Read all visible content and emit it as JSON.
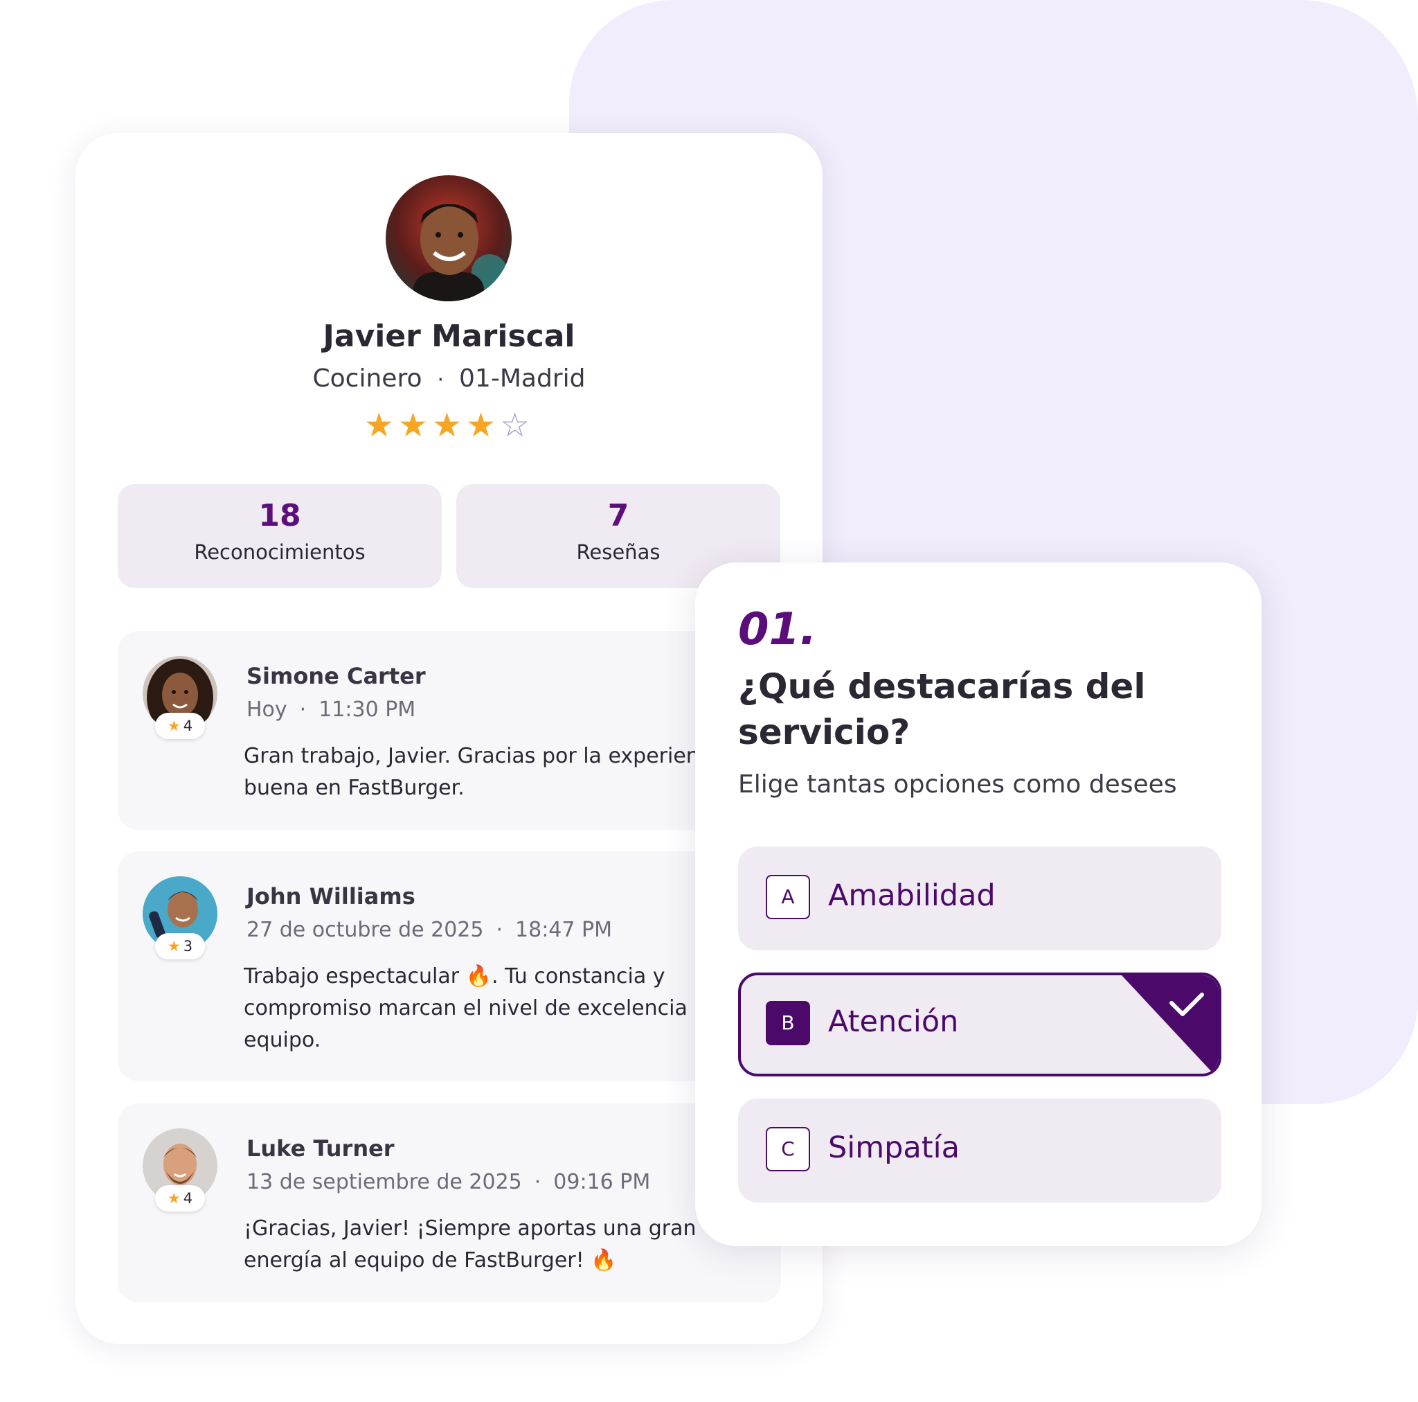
{
  "profile": {
    "name": "Javier Mariscal",
    "role": "Cocinero",
    "location": "01-Madrid",
    "separator": "·",
    "rating": 4,
    "rating_max": 5,
    "stats": [
      {
        "value": "18",
        "label": "Reconocimientos"
      },
      {
        "value": "7",
        "label": "Reseñas"
      }
    ]
  },
  "reviews": [
    {
      "author": "Simone Carter",
      "date": "Hoy",
      "time": "11:30 PM",
      "stars": "4",
      "text": "Gran trabajo, Javier. Gracias por la experien tan buena en FastBurger."
    },
    {
      "author": "John Williams",
      "date": "27 de octubre de 2025",
      "time": "18:47 PM",
      "stars": "3",
      "text": "Trabajo espectacular 🔥. Tu constancia y compromiso marcan el nivel de excelencia d equipo."
    },
    {
      "author": "Luke Turner",
      "date": "13 de septiembre de 2025",
      "time": "09:16 PM",
      "stars": "4",
      "text": "¡Gracias, Javier! ¡Siempre aportas una gran energía al equipo de FastBurger! 🔥"
    }
  ],
  "quiz": {
    "number": "01.",
    "question": "¿Qué destacarías del servicio?",
    "help": "Elige tantas opciones como desees",
    "options": [
      {
        "key": "A",
        "label": "Amabilidad",
        "selected": false
      },
      {
        "key": "B",
        "label": "Atención",
        "selected": true
      },
      {
        "key": "C",
        "label": "Simpatía",
        "selected": false
      }
    ]
  },
  "colors": {
    "accent": "#5a0e79",
    "star": "#f6a623",
    "background_blob": "#f1edfc"
  }
}
